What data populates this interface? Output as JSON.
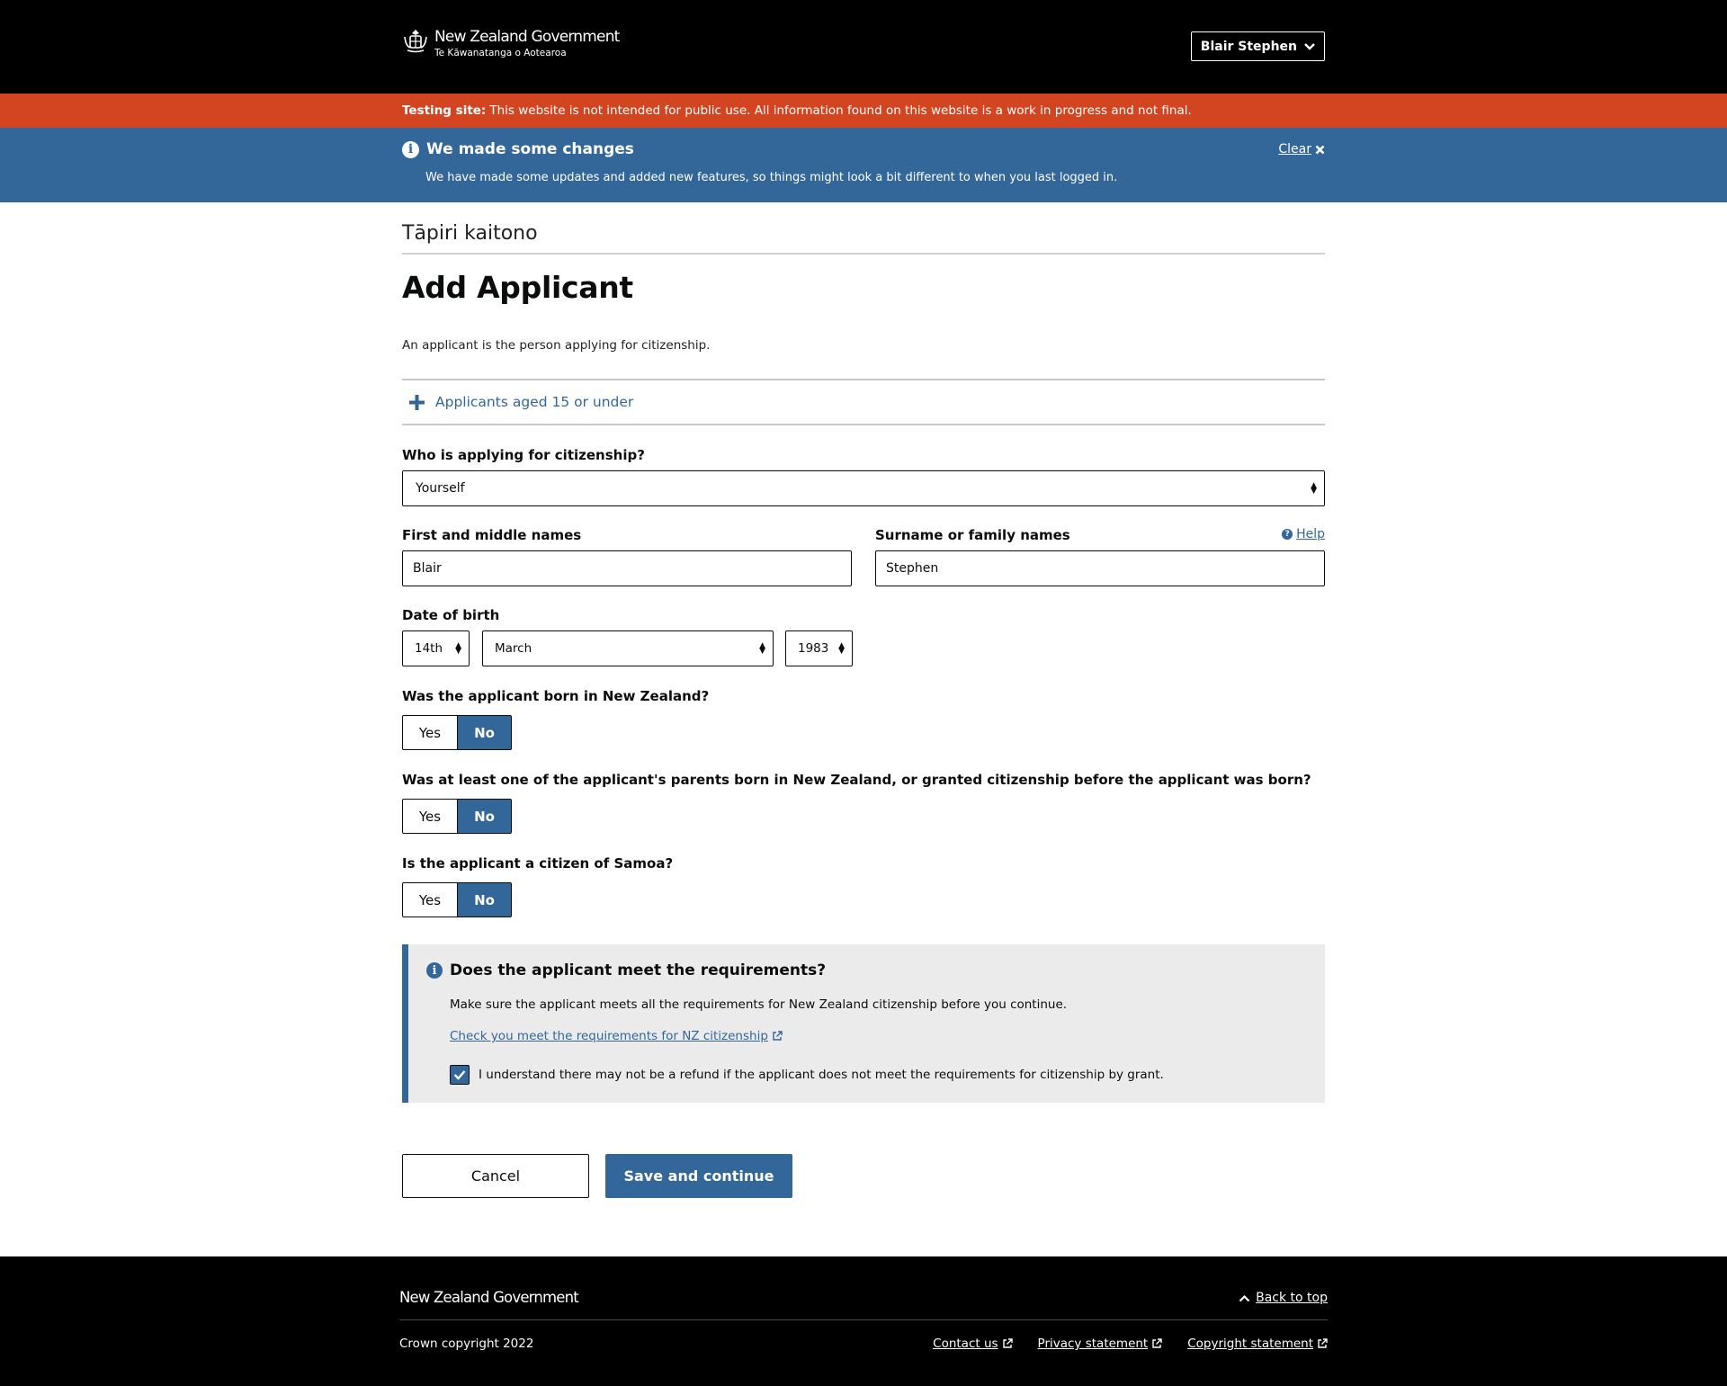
{
  "header": {
    "logo_line1": "New Zealand Government",
    "logo_line2": "Te Kāwanatanga o Aotearoa",
    "user_name": "Blair Stephen"
  },
  "testing_bar": {
    "label": "Testing site:",
    "text": "This website is not intended for public use. All information found on this website is a work in progress and not final."
  },
  "notice": {
    "title": "We made some changes",
    "text": "We have made some updates and added new features, so things might look a bit different to when you last logged in.",
    "clear_label": "Clear"
  },
  "page": {
    "maori_title": "Tāpiri kaitono",
    "title": "Add Applicant",
    "intro": "An applicant is the person applying for citizenship.",
    "accordion_label": "Applicants aged 15 or under"
  },
  "form": {
    "who_label": "Who is applying for citizenship?",
    "who_value": "Yourself",
    "first_label": "First and middle names",
    "first_value": "Blair",
    "surname_label": "Surname or family names",
    "surname_value": "Stephen",
    "help_label": "Help",
    "dob_label": "Date of birth",
    "dob_day": "14th",
    "dob_month": "March",
    "dob_year": "1983",
    "q1": "Was the applicant born in New Zealand?",
    "q2": "Was at least one of the applicant's parents born in New Zealand, or granted citizenship before the applicant was born?",
    "q3": "Is the applicant a citizen of Samoa?",
    "yes_label": "Yes",
    "no_label": "No",
    "selected": "No"
  },
  "requirements": {
    "title": "Does the applicant meet the requirements?",
    "text": "Make sure the applicant meets all the requirements for New Zealand citizenship before you continue.",
    "link": "Check you meet the requirements for NZ citizenship",
    "checkbox_label": "I understand there may not be a refund if the applicant does not meet the requirements for citizenship by grant.",
    "checked": true
  },
  "actions": {
    "cancel": "Cancel",
    "save": "Save and continue"
  },
  "footer": {
    "logo": "New Zealand Government",
    "back_to_top": "Back to top",
    "copyright": "Crown copyright 2022",
    "links": [
      "Contact us",
      "Privacy statement",
      "Copyright statement"
    ]
  },
  "colors": {
    "primary": "#336699",
    "testing": "#d34420",
    "header_bg": "#000000",
    "panel_bg": "#ebebeb"
  }
}
